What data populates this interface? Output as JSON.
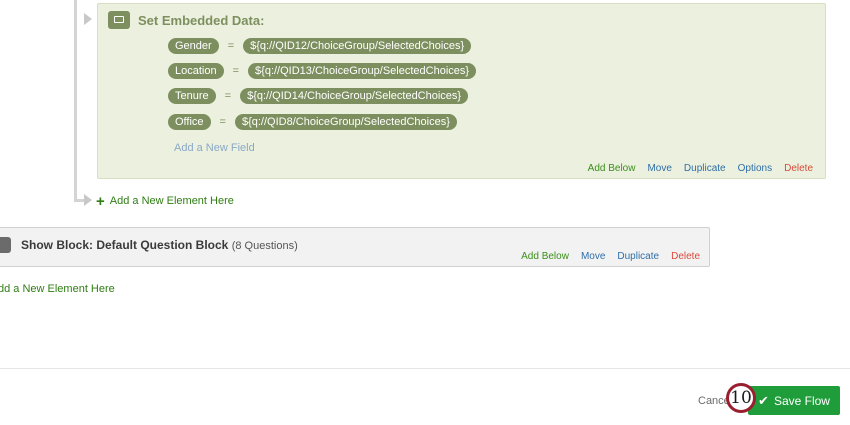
{
  "embedded_data": {
    "title": "Set Embedded Data:",
    "fields": [
      {
        "name": "Gender",
        "value": "${q://QID12/ChoiceGroup/SelectedChoices}"
      },
      {
        "name": "Location",
        "value": "${q://QID13/ChoiceGroup/SelectedChoices}"
      },
      {
        "name": "Tenure",
        "value": "${q://QID14/ChoiceGroup/SelectedChoices}"
      },
      {
        "name": "Office",
        "value": "${q://QID8/ChoiceGroup/SelectedChoices}"
      }
    ],
    "equals_sign": "=",
    "add_field_label": "Add a New Field",
    "actions": {
      "add_below": "Add Below",
      "move": "Move",
      "duplicate": "Duplicate",
      "options": "Options",
      "delete": "Delete"
    }
  },
  "add_element_label": "Add a New Element Here",
  "block": {
    "title": "Show Block: Default Question Block",
    "count": "(8 Questions)",
    "actions": {
      "add_below": "Add Below",
      "move": "Move",
      "duplicate": "Duplicate",
      "delete": "Delete"
    }
  },
  "add_element_label_2": "dd a New Element Here",
  "footer": {
    "cancel_label": "Cance",
    "save_label": "Save Flow",
    "step_number": "10"
  },
  "colors": {
    "embedded_bg": "#ebf1de",
    "pill": "#7d8f5f",
    "save_button": "#1f9d3a",
    "badge_border": "#9a1f2e"
  }
}
